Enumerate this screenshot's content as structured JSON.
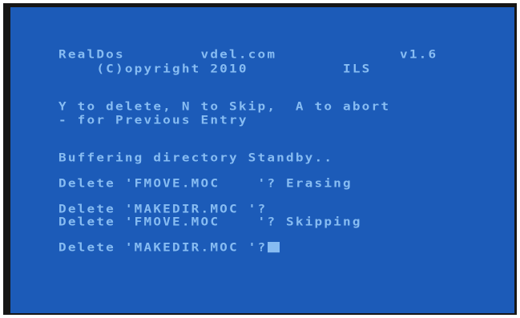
{
  "terminal": {
    "lines": [
      "RealDos        vdel.com             v1.6",
      "    (C)opyright 2010          ILS",
      "Y to delete, N to Skip,  A to abort",
      "- for Previous Entry",
      "Buffering directory Standby..",
      "Delete 'FMOVE.MOC    '? Erasing",
      "Delete 'MAKEDIR.MOC '?",
      "Delete 'FMOVE.MOC    '? Skipping",
      "Delete 'MAKEDIR.MOC '?"
    ]
  },
  "colors": {
    "screen_background": "#1c5bb8",
    "text": "#87bcf2",
    "border": "#161616"
  }
}
